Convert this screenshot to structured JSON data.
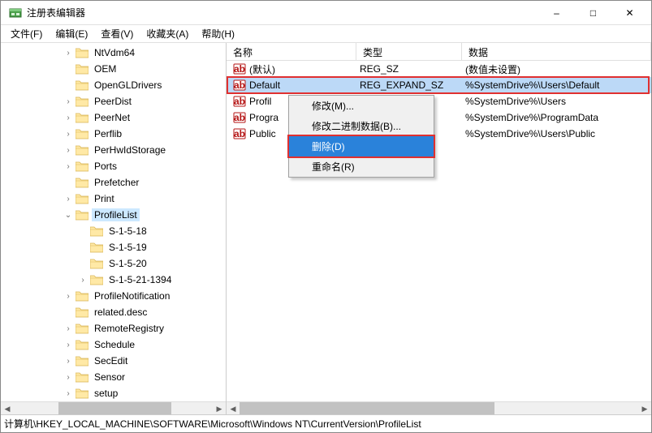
{
  "window": {
    "title": "注册表编辑器"
  },
  "winbuttons": {
    "min": "–",
    "max": "□",
    "close": "✕"
  },
  "menu": {
    "file": "文件(F)",
    "edit": "编辑(E)",
    "view": "查看(V)",
    "favorites": "收藏夹(A)",
    "help": "帮助(H)"
  },
  "tree": {
    "items": [
      {
        "label": "NtVdm64",
        "indent": 4,
        "toggle": ">"
      },
      {
        "label": "OEM",
        "indent": 4,
        "toggle": ""
      },
      {
        "label": "OpenGLDrivers",
        "indent": 4,
        "toggle": ""
      },
      {
        "label": "PeerDist",
        "indent": 4,
        "toggle": ">"
      },
      {
        "label": "PeerNet",
        "indent": 4,
        "toggle": ">"
      },
      {
        "label": "Perflib",
        "indent": 4,
        "toggle": ">"
      },
      {
        "label": "PerHwIdStorage",
        "indent": 4,
        "toggle": ">"
      },
      {
        "label": "Ports",
        "indent": 4,
        "toggle": ">"
      },
      {
        "label": "Prefetcher",
        "indent": 4,
        "toggle": ""
      },
      {
        "label": "Print",
        "indent": 4,
        "toggle": ">"
      },
      {
        "label": "ProfileList",
        "indent": 4,
        "toggle": "v",
        "selected": true
      },
      {
        "label": "S-1-5-18",
        "indent": 5,
        "toggle": ""
      },
      {
        "label": "S-1-5-19",
        "indent": 5,
        "toggle": ""
      },
      {
        "label": "S-1-5-20",
        "indent": 5,
        "toggle": ""
      },
      {
        "label": "S-1-5-21-1394",
        "indent": 5,
        "toggle": ">"
      },
      {
        "label": "ProfileNotification",
        "indent": 4,
        "toggle": ">"
      },
      {
        "label": "related.desc",
        "indent": 4,
        "toggle": ""
      },
      {
        "label": "RemoteRegistry",
        "indent": 4,
        "toggle": ">"
      },
      {
        "label": "Schedule",
        "indent": 4,
        "toggle": ">"
      },
      {
        "label": "SecEdit",
        "indent": 4,
        "toggle": ">"
      },
      {
        "label": "Sensor",
        "indent": 4,
        "toggle": ">"
      },
      {
        "label": "setup",
        "indent": 4,
        "toggle": ">"
      }
    ]
  },
  "list": {
    "header": {
      "name": "名称",
      "type": "类型",
      "data": "数据"
    },
    "rows": [
      {
        "name": "(默认)",
        "type": "REG_SZ",
        "data": "(数值未设置)"
      },
      {
        "name": "Default",
        "type": "REG_EXPAND_SZ",
        "data": "%SystemDrive%\\Users\\Default",
        "selected": true,
        "highlighted": true
      },
      {
        "name": "Profil",
        "type": "",
        "data": "%SystemDrive%\\Users"
      },
      {
        "name": "Progra",
        "type": "",
        "data": "%SystemDrive%\\ProgramData"
      },
      {
        "name": "Public",
        "type": "",
        "data": "%SystemDrive%\\Users\\Public"
      }
    ]
  },
  "contextmenu": {
    "modify": "修改(M)...",
    "modify_binary": "修改二进制数据(B)...",
    "delete": "删除(D)",
    "rename": "重命名(R)"
  },
  "statusbar": {
    "path": "计算机\\HKEY_LOCAL_MACHINE\\SOFTWARE\\Microsoft\\Windows NT\\CurrentVersion\\ProfileList"
  }
}
